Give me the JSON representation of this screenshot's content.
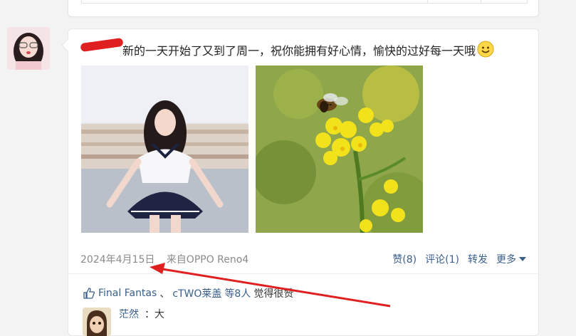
{
  "post": {
    "text": "新的一天开始了又到了周一，祝你能拥有好心情，愉快的过好每一天哦",
    "date": "2024年4月15日",
    "source": "来自OPPO Reno4",
    "actions": {
      "like": "赞(8)",
      "comment": "评论(1)",
      "share": "转发",
      "more": "更多"
    }
  },
  "likes": {
    "names": [
      "Final Fantas",
      "cTWO莱盖"
    ],
    "separator": "、",
    "suffix_count": "等8人",
    "suffix_text": "觉得很赞"
  },
  "comment": {
    "name": "茫然",
    "text": "：大"
  },
  "icons": {
    "smile": "smile-emoji-icon",
    "thumb": "thumbs-up-icon",
    "caret": "caret-down-icon"
  },
  "colors": {
    "link": "#3a5f8c",
    "annotation": "#e02020"
  }
}
